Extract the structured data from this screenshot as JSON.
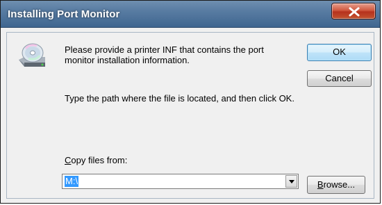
{
  "window": {
    "title": "Installing Port Monitor"
  },
  "icons": {
    "disk": "cd-drive-icon",
    "close": "close-icon",
    "dropdown": "chevron-down-icon"
  },
  "message": {
    "primary": "Please provide a printer INF that contains the port monitor installation information.",
    "secondary": "Type the path where the file is located, and then click OK."
  },
  "buttons": {
    "ok": "OK",
    "cancel": "Cancel",
    "browse_prefix": "",
    "browse_hotkey": "B",
    "browse_rest": "rowse..."
  },
  "copy_from": {
    "label_hotkey": "C",
    "label_rest": "opy files from:",
    "value": "M:\\"
  },
  "colors": {
    "titlebar": "#5a7da3",
    "selection": "#3399ff",
    "close": "#c2532f"
  }
}
